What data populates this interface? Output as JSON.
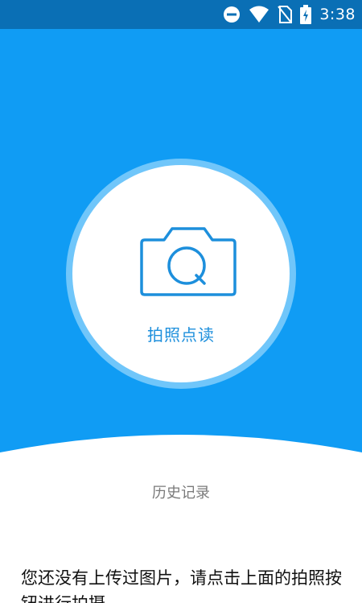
{
  "status_bar": {
    "time": "3:38",
    "icons": [
      "do-not-disturb-icon",
      "wifi-icon",
      "no-sim-icon",
      "battery-charging-icon"
    ]
  },
  "main": {
    "photo_button_label": "拍照点读",
    "history_label": "历史记录",
    "empty_message": "您还没有上传过图片，请点击上面的拍照按钮进行拍摄"
  },
  "colors": {
    "status_bar": "#0a6fb5",
    "hero_background": "#109cf4",
    "accent": "#1d8fdc",
    "ring": "#70c6fa"
  }
}
